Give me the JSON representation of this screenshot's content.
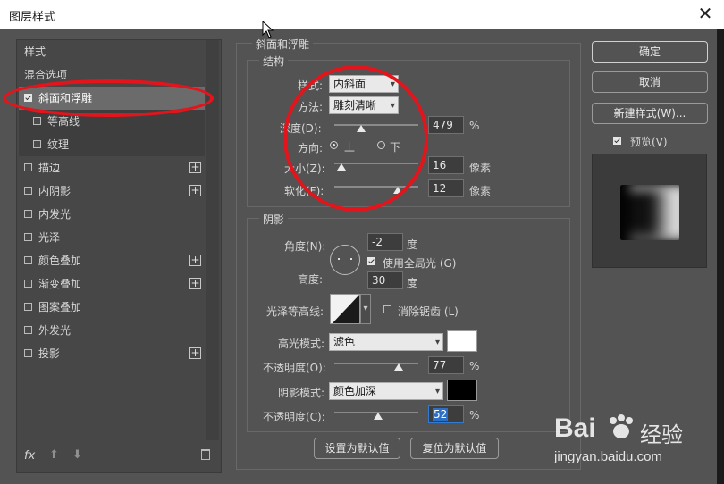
{
  "window": {
    "title": "图层样式",
    "close_glyph": "✕"
  },
  "sidebar": {
    "items": [
      {
        "label": "样式",
        "type": "header"
      },
      {
        "label": "混合选项",
        "type": "header"
      },
      {
        "label": "斜面和浮雕",
        "checked": true,
        "selected": true
      },
      {
        "label": "等高线",
        "checked": false,
        "sub": true
      },
      {
        "label": "纹理",
        "checked": false,
        "sub": true
      },
      {
        "label": "描边",
        "checked": false,
        "plus": true
      },
      {
        "label": "内阴影",
        "checked": false,
        "plus": true
      },
      {
        "label": "内发光",
        "checked": false
      },
      {
        "label": "光泽",
        "checked": false
      },
      {
        "label": "颜色叠加",
        "checked": false,
        "plus": true
      },
      {
        "label": "渐变叠加",
        "checked": false,
        "plus": true
      },
      {
        "label": "图案叠加",
        "checked": false
      },
      {
        "label": "外发光",
        "checked": false
      },
      {
        "label": "投影",
        "checked": false,
        "plus": true
      }
    ],
    "plus_glyph": "+",
    "footer": {
      "fx_label": "fx",
      "up_glyph": "⬆",
      "down_glyph": "⬇"
    }
  },
  "bevel": {
    "group_title": "斜面和浮雕",
    "structure": {
      "title": "结构",
      "style_label": "样式:",
      "style_value": "内斜面",
      "technique_label": "方法:",
      "technique_value": "雕刻清晰",
      "depth_label": "深度(D):",
      "depth_value": "479",
      "depth_unit": "%",
      "depth_slider": 0.32,
      "direction_label": "方向:",
      "direction_up": "上",
      "direction_down": "下",
      "direction_selected": "上",
      "size_label": "大小(Z):",
      "size_value": "16",
      "size_unit": "像素",
      "size_slider": 0.08,
      "soften_label": "软化(F):",
      "soften_value": "12",
      "soften_unit": "像素",
      "soften_slider": 0.75
    },
    "shading": {
      "title": "阴影",
      "angle_label": "角度(N):",
      "angle_value": "-2",
      "angle_unit": "度",
      "global_light_label": "使用全局光 (G)",
      "global_light_checked": true,
      "altitude_label": "高度:",
      "altitude_value": "30",
      "altitude_unit": "度",
      "gloss_contour_label": "光泽等高线:",
      "antialias_label": "消除锯齿 (L)",
      "antialias_checked": false,
      "highlight_mode_label": "高光模式:",
      "highlight_mode_value": "滤色",
      "highlight_color": "#ffffff",
      "highlight_opacity_label": "不透明度(O):",
      "highlight_opacity_value": "77",
      "highlight_opacity_unit": "%",
      "highlight_opacity_slider": 0.77,
      "shadow_mode_label": "阴影模式:",
      "shadow_mode_value": "颜色加深",
      "shadow_color": "#000000",
      "shadow_opacity_label": "不透明度(C):",
      "shadow_opacity_value": "52",
      "shadow_opacity_unit": "%",
      "shadow_opacity_slider": 0.52
    },
    "make_default_label": "设置为默认值",
    "reset_default_label": "复位为默认值"
  },
  "actions": {
    "ok_label": "确定",
    "cancel_label": "取消",
    "new_style_label": "新建样式(W)...",
    "preview_label": "预览(V)",
    "preview_checked": true
  },
  "dropdown_arrow": "▾",
  "watermark": {
    "brand": "Bai",
    "brand2": "经验",
    "url": "jingyan.baidu.com"
  },
  "colors": {
    "dialog_bg": "#535353",
    "annotation_red": "#e3141b",
    "focus_blue": "#2f7bd6"
  }
}
